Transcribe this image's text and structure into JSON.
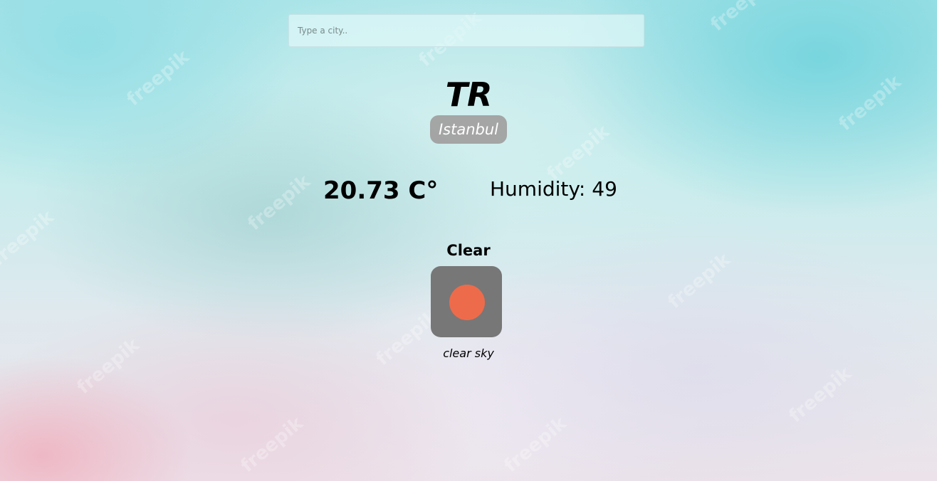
{
  "search": {
    "placeholder": "Type a city..",
    "value": ""
  },
  "location": {
    "country": "TR",
    "city": "Istanbul"
  },
  "weather": {
    "temperature": "20.73 C°",
    "humidity": "Humidity: 49",
    "condition": "Clear",
    "description": "clear sky",
    "icon": "sun-icon"
  },
  "background": {
    "watermark": "freepik"
  },
  "colors": {
    "sun": "#ED6B4B",
    "icon_tile": "#777777",
    "city_badge": "#968C8C"
  }
}
